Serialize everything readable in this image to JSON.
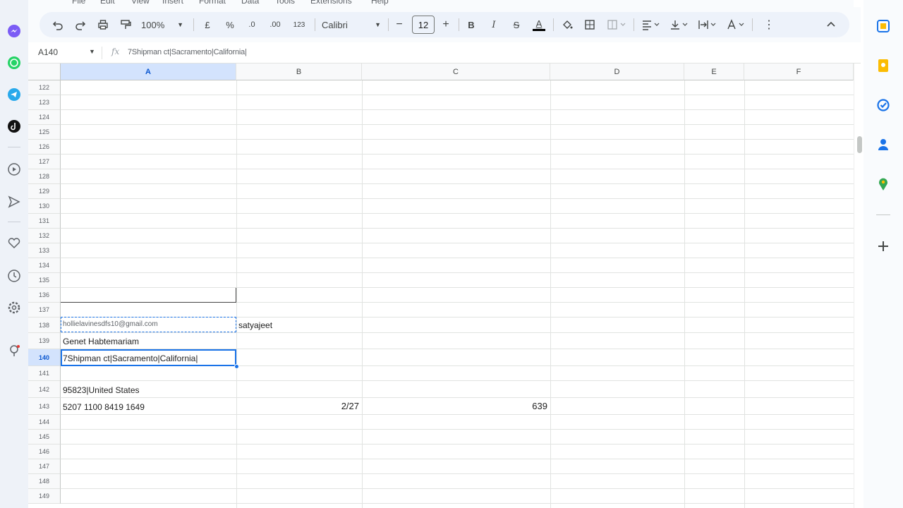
{
  "menu": {
    "items": [
      "File",
      "Edit",
      "View",
      "Insert",
      "Format",
      "Data",
      "Tools",
      "Extensions",
      "Help"
    ]
  },
  "toolbar": {
    "zoom": "100%",
    "currency": "£",
    "percent": "%",
    "decrease_decimals": ".0",
    "increase_decimals": ".00",
    "number_format": "123",
    "font": "Calibri",
    "font_size": "12",
    "minus": "−",
    "plus": "+",
    "bold": "B",
    "italic": "I",
    "strikethrough": "S",
    "text_color": "A",
    "text_color_value": "#000000",
    "more": "⋮",
    "collapse": "⌃"
  },
  "formula_bar": {
    "name_box": "A140",
    "fx": "fx",
    "formula": "7Shipman ct|Sacramento|California|"
  },
  "columns": [
    "A",
    "B",
    "C",
    "D",
    "E",
    "F"
  ],
  "selected_column": "A",
  "rows": [
    "122",
    "123",
    "124",
    "125",
    "126",
    "127",
    "128",
    "129",
    "130",
    "131",
    "132",
    "133",
    "134",
    "135",
    "136",
    "137",
    "138",
    "139",
    "140",
    "141",
    "142",
    "143",
    "144",
    "145",
    "146",
    "147",
    "148",
    "149"
  ],
  "selected_row": "140",
  "cells": {
    "A138": "hollielavinesdfs10@gmail.com",
    "B138": "satyajeet",
    "A139": "Genet Habtemariam",
    "A140": "7Shipman ct|Sacramento|California|",
    "A142": "95823|United States",
    "A143": "5207 1100 8419 1649",
    "B143": "2/27",
    "C143": "639"
  },
  "colors": {
    "accent": "#1a73e8",
    "selected_header_bg": "#d3e3fd",
    "toolbar_bg": "#edf2fa"
  }
}
